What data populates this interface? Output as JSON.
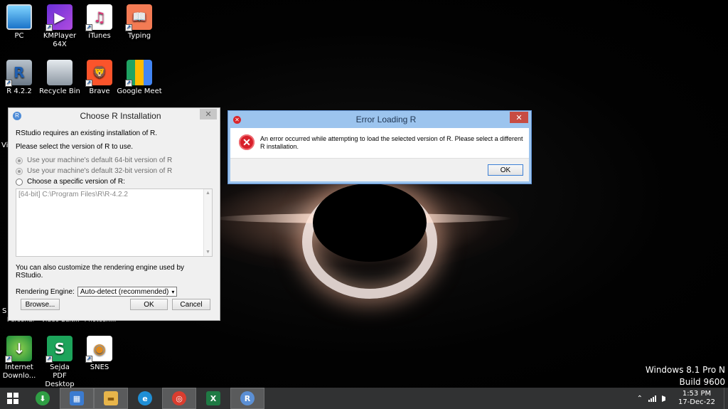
{
  "desktop": {
    "icons": [
      {
        "label": "PC",
        "icon": "monitor-icon"
      },
      {
        "label": "KMPlayer 64X",
        "icon": "kmplayer-icon"
      },
      {
        "label": "iTunes",
        "icon": "itunes-icon"
      },
      {
        "label": "Typing",
        "icon": "typing-book-icon"
      },
      {
        "label": "R 4.2.2",
        "icon": "r-logo-icon"
      },
      {
        "label": "Recycle Bin",
        "icon": "recycle-bin-icon"
      },
      {
        "label": "Brave",
        "icon": "brave-lion-icon"
      },
      {
        "label": "Google Meet",
        "icon": "google-meet-icon"
      },
      {
        "label": "Internet Downlo...",
        "icon": "idm-globe-icon"
      },
      {
        "label": "Sejda PDF Desktop",
        "icon": "sejda-icon"
      },
      {
        "label": "SNES",
        "icon": "snes-eye-icon"
      }
    ],
    "partial_labels": [
      "Personal",
      "Video Edit...",
      "Photosh..."
    ],
    "edge_letters": [
      "Vi",
      "S"
    ],
    "glyphs": {
      "km": "▶",
      "itunes": "♫",
      "typing": "📖",
      "r": "R",
      "brave": "🦁",
      "idm": "↓",
      "sejda": "S",
      "snes": "◉",
      "shortcut": "↗"
    }
  },
  "chooser": {
    "title": "Choose R Installation",
    "title_icon_letter": "R",
    "intro": "RStudio requires an existing installation of R.",
    "prompt": "Please select the version of R to use.",
    "options": [
      {
        "label": "Use your machine's default 64-bit version of R",
        "enabled": false
      },
      {
        "label": "Use your machine's default 32-bit version of R",
        "enabled": false
      },
      {
        "label": "Choose a specific version of R:",
        "enabled": true
      }
    ],
    "list_items": [
      "[64-bit] C:\\Program Files\\R\\R-4.2.2"
    ],
    "note": "You can also customize the rendering engine used by RStudio.",
    "engine_label": "Rendering Engine:",
    "engine_value": "Auto-detect (recommended)",
    "browse_label": "Browse...",
    "ok_label": "OK",
    "cancel_label": "Cancel",
    "close_glyph": "✕",
    "scroll_up": "▲",
    "scroll_down": "▼",
    "caret": "▾"
  },
  "error_dialog": {
    "title": "Error Loading R",
    "message": "An error occurred while attempting to load the selected version of R. Please select a different R installation.",
    "ok_label": "OK",
    "close_glyph": "✕",
    "icon_glyph": "✕"
  },
  "os_watermark": {
    "line1": "Windows 8.1 Pro N",
    "line2": "Build 9600"
  },
  "taskbar": {
    "items": [
      {
        "name": "idm",
        "glyph": "⬇",
        "color": "#2f9e44"
      },
      {
        "name": "control-panel",
        "glyph": "▦",
        "color": "#3b7bd0"
      },
      {
        "name": "file-explorer",
        "glyph": "▬",
        "color": "#e8b54a"
      },
      {
        "name": "edge",
        "glyph": "e",
        "color": "#1f8fd6"
      },
      {
        "name": "chrome",
        "glyph": "◎",
        "color": "#d93d2f"
      },
      {
        "name": "excel",
        "glyph": "X",
        "color": "#1f7a44"
      },
      {
        "name": "rstudio",
        "glyph": "R",
        "color": "#5b8fd4"
      }
    ],
    "tray_chevron": "⌃",
    "time": "1:53 PM",
    "date": "17-Dec-22"
  }
}
